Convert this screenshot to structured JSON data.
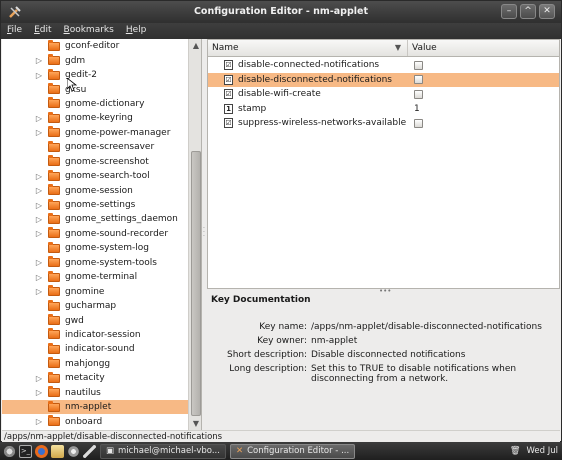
{
  "window": {
    "title": "Configuration Editor - nm-applet",
    "buttons": [
      "minimize",
      "maximize",
      "close"
    ]
  },
  "menubar": [
    {
      "first": "F",
      "rest": "ile"
    },
    {
      "first": "E",
      "rest": "dit"
    },
    {
      "first": "B",
      "rest": "ookmarks"
    },
    {
      "first": "H",
      "rest": "elp"
    }
  ],
  "tree": {
    "items": [
      {
        "label": "gconf-editor",
        "expandable": false,
        "selected": false
      },
      {
        "label": "gdm",
        "expandable": true,
        "selected": false
      },
      {
        "label": "gedit-2",
        "expandable": true,
        "selected": false
      },
      {
        "label": "gksu",
        "expandable": false,
        "selected": false
      },
      {
        "label": "gnome-dictionary",
        "expandable": false,
        "selected": false
      },
      {
        "label": "gnome-keyring",
        "expandable": true,
        "selected": false
      },
      {
        "label": "gnome-power-manager",
        "expandable": true,
        "selected": false
      },
      {
        "label": "gnome-screensaver",
        "expandable": false,
        "selected": false
      },
      {
        "label": "gnome-screenshot",
        "expandable": false,
        "selected": false
      },
      {
        "label": "gnome-search-tool",
        "expandable": true,
        "selected": false
      },
      {
        "label": "gnome-session",
        "expandable": true,
        "selected": false
      },
      {
        "label": "gnome-settings",
        "expandable": true,
        "selected": false
      },
      {
        "label": "gnome_settings_daemon",
        "expandable": true,
        "selected": false
      },
      {
        "label": "gnome-sound-recorder",
        "expandable": true,
        "selected": false
      },
      {
        "label": "gnome-system-log",
        "expandable": false,
        "selected": false
      },
      {
        "label": "gnome-system-tools",
        "expandable": true,
        "selected": false
      },
      {
        "label": "gnome-terminal",
        "expandable": true,
        "selected": false
      },
      {
        "label": "gnomine",
        "expandable": true,
        "selected": false
      },
      {
        "label": "gucharmap",
        "expandable": false,
        "selected": false
      },
      {
        "label": "gwd",
        "expandable": false,
        "selected": false
      },
      {
        "label": "indicator-session",
        "expandable": false,
        "selected": false
      },
      {
        "label": "indicator-sound",
        "expandable": false,
        "selected": false
      },
      {
        "label": "mahjongg",
        "expandable": false,
        "selected": false
      },
      {
        "label": "metacity",
        "expandable": true,
        "selected": false
      },
      {
        "label": "nautilus",
        "expandable": true,
        "selected": false
      },
      {
        "label": "nm-applet",
        "expandable": false,
        "selected": true
      },
      {
        "label": "onboard",
        "expandable": true,
        "selected": false
      }
    ]
  },
  "table": {
    "col_name": "Name",
    "col_value": "Value",
    "rows": [
      {
        "name": "disable-connected-notifications",
        "type": "bool",
        "value": "",
        "selected": false
      },
      {
        "name": "disable-disconnected-notifications",
        "type": "bool",
        "value": "",
        "selected": true
      },
      {
        "name": "disable-wifi-create",
        "type": "bool",
        "value": "",
        "selected": false
      },
      {
        "name": "stamp",
        "type": "int",
        "value": "1",
        "selected": false
      },
      {
        "name": "suppress-wireless-networks-available",
        "type": "bool",
        "value": "",
        "selected": false
      }
    ]
  },
  "doc": {
    "title": "Key Documentation",
    "rows": [
      {
        "key": "Key name:",
        "value": "/apps/nm-applet/disable-disconnected-notifications"
      },
      {
        "key": "Key owner:",
        "value": "nm-applet"
      },
      {
        "key": "Short description:",
        "value": "Disable disconnected notifications"
      },
      {
        "key": "Long description:",
        "value": "Set this to TRUE to disable notifications when disconnecting from a network."
      }
    ]
  },
  "statusbar": {
    "path": "/apps/nm-applet/disable-disconnected-notifications"
  },
  "taskbar": {
    "task1": "michael@michael-vbo...",
    "task2": "Configuration Editor - ...",
    "clock": "Wed Jul"
  },
  "colors": {
    "selection": "#f7b985",
    "folder": "#e96e17"
  }
}
